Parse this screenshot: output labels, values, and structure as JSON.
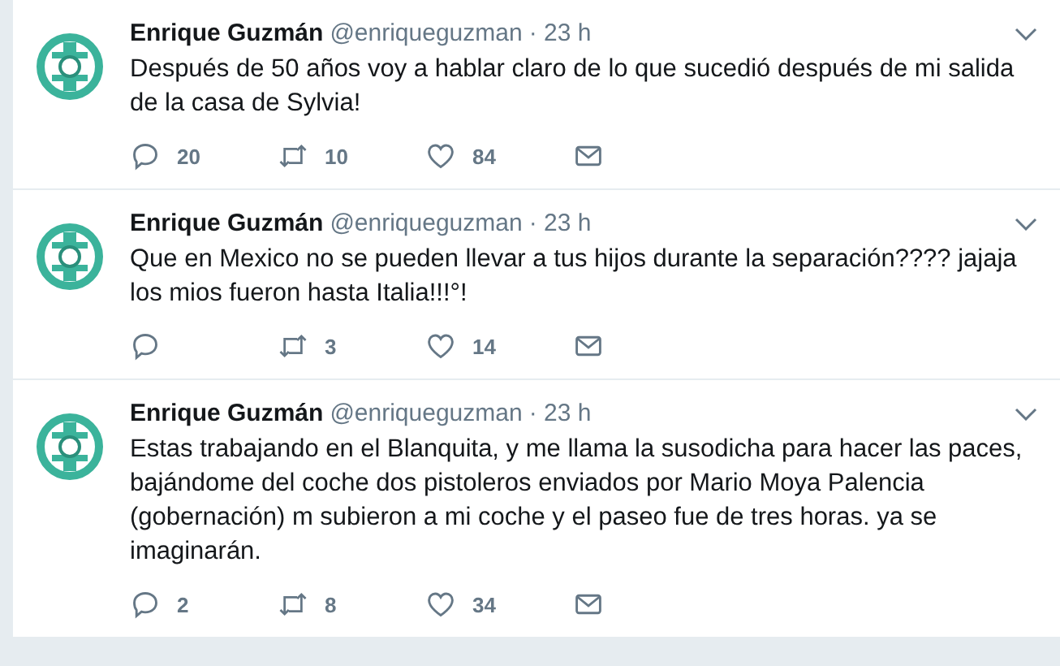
{
  "tweets": [
    {
      "name": "Enrique Guzmán",
      "handle": "@enriqueguzman",
      "time": "· 23 h",
      "text": "Después de 50 años voy a hablar claro de lo que sucedió después de mi salida de la casa de Sylvia!",
      "actions": [
        {
          "kind": "reply",
          "count": "20"
        },
        {
          "kind": "retweet",
          "count": "10"
        },
        {
          "kind": "like",
          "count": "84"
        },
        {
          "kind": "message"
        }
      ]
    },
    {
      "name": "Enrique Guzmán",
      "handle": "@enriqueguzman",
      "time": "· 23 h",
      "text": "Que en Mexico no se pueden llevar a tus hijos durante la separación???? jajaja los mios fueron hasta Italia!!!°!",
      "actions": [
        {
          "kind": "reply"
        },
        {
          "kind": "retweet",
          "count": "3"
        },
        {
          "kind": "like",
          "count": "14"
        },
        {
          "kind": "message"
        }
      ]
    },
    {
      "name": "Enrique Guzmán",
      "handle": "@enriqueguzman",
      "time": "· 23 h",
      "text": "Estas trabajando en el Blanquita, y me llama la susodicha para hacer las paces, bajándome del coche dos pistoleros enviados por Mario Moya Palencia (gobernación) m subieron a mi coche y el paseo fue de tres horas. ya se imaginarán.",
      "actions": [
        {
          "kind": "reply",
          "count": "2"
        },
        {
          "kind": "retweet",
          "count": "8"
        },
        {
          "kind": "like",
          "count": "34"
        },
        {
          "kind": "message"
        }
      ]
    }
  ]
}
